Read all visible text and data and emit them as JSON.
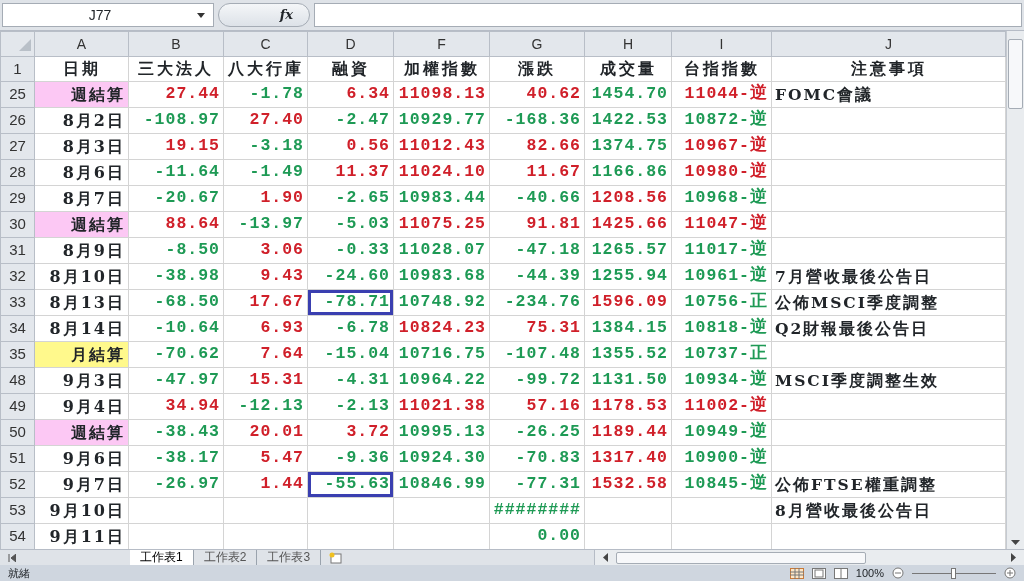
{
  "name_box": "J77",
  "formula_label": "fx",
  "columns": [
    "A",
    "B",
    "C",
    "D",
    "F",
    "G",
    "H",
    "I",
    "J"
  ],
  "header_row": {
    "number": "1",
    "labels": [
      "日期",
      "三大法人",
      "八大行庫",
      "融資",
      "加權指數",
      "漲跌",
      "成交量",
      "台指指數",
      "注意事項"
    ]
  },
  "rows": [
    {
      "number": "25",
      "date": {
        "text": "週結算",
        "kind": "weekly"
      },
      "cells": [
        {
          "text": "27.44",
          "color": "#d0202a",
          "selected": false
        },
        {
          "text": "-1.78",
          "color": "#1e9a55",
          "selected": false
        },
        {
          "text": "6.34",
          "color": "#d0202a",
          "selected": false
        },
        {
          "text": "11098.13",
          "color": "#d0202a",
          "selected": false
        },
        {
          "text": "40.62",
          "color": "#d0202a",
          "selected": false
        },
        {
          "text": "1454.70",
          "color": "#1e9a55",
          "selected": false
        },
        {
          "text": "11044-逆",
          "color": "#d0202a",
          "selected": false
        }
      ],
      "note": "FOMC會議"
    },
    {
      "number": "26",
      "date": {
        "text": "8月2日",
        "kind": "day"
      },
      "cells": [
        {
          "text": "-108.97",
          "color": "#1e9a55",
          "selected": false
        },
        {
          "text": "27.40",
          "color": "#d0202a",
          "selected": false
        },
        {
          "text": "-2.47",
          "color": "#1e9a55",
          "selected": false
        },
        {
          "text": "10929.77",
          "color": "#1e9a55",
          "selected": false
        },
        {
          "text": "-168.36",
          "color": "#1e9a55",
          "selected": false
        },
        {
          "text": "1422.53",
          "color": "#1e9a55",
          "selected": false
        },
        {
          "text": "10872-逆",
          "color": "#1e9a55",
          "selected": false
        }
      ]
    },
    {
      "number": "27",
      "date": {
        "text": "8月3日",
        "kind": "day"
      },
      "cells": [
        {
          "text": "19.15",
          "color": "#d0202a",
          "selected": false
        },
        {
          "text": "-3.18",
          "color": "#1e9a55",
          "selected": false
        },
        {
          "text": "0.56",
          "color": "#d0202a",
          "selected": false
        },
        {
          "text": "11012.43",
          "color": "#d0202a",
          "selected": false
        },
        {
          "text": "82.66",
          "color": "#d0202a",
          "selected": false
        },
        {
          "text": "1374.75",
          "color": "#1e9a55",
          "selected": false
        },
        {
          "text": "10967-逆",
          "color": "#d0202a",
          "selected": false
        }
      ]
    },
    {
      "number": "28",
      "date": {
        "text": "8月6日",
        "kind": "day"
      },
      "cells": [
        {
          "text": "-11.64",
          "color": "#1e9a55",
          "selected": false
        },
        {
          "text": "-1.49",
          "color": "#1e9a55",
          "selected": false
        },
        {
          "text": "11.37",
          "color": "#d0202a",
          "selected": false
        },
        {
          "text": "11024.10",
          "color": "#d0202a",
          "selected": false
        },
        {
          "text": "11.67",
          "color": "#d0202a",
          "selected": false
        },
        {
          "text": "1166.86",
          "color": "#1e9a55",
          "selected": false
        },
        {
          "text": "10980-逆",
          "color": "#d0202a",
          "selected": false
        }
      ]
    },
    {
      "number": "29",
      "date": {
        "text": "8月7日",
        "kind": "day"
      },
      "cells": [
        {
          "text": "-20.67",
          "color": "#1e9a55",
          "selected": false
        },
        {
          "text": "1.90",
          "color": "#d0202a",
          "selected": false
        },
        {
          "text": "-2.65",
          "color": "#1e9a55",
          "selected": false
        },
        {
          "text": "10983.44",
          "color": "#1e9a55",
          "selected": false
        },
        {
          "text": "-40.66",
          "color": "#1e9a55",
          "selected": false
        },
        {
          "text": "1208.56",
          "color": "#d0202a",
          "selected": false
        },
        {
          "text": "10968-逆",
          "color": "#1e9a55",
          "selected": false
        }
      ]
    },
    {
      "number": "30",
      "date": {
        "text": "週結算",
        "kind": "weekly"
      },
      "cells": [
        {
          "text": "88.64",
          "color": "#d0202a",
          "selected": false
        },
        {
          "text": "-13.97",
          "color": "#1e9a55",
          "selected": false
        },
        {
          "text": "-5.03",
          "color": "#1e9a55",
          "selected": false
        },
        {
          "text": "11075.25",
          "color": "#d0202a",
          "selected": false
        },
        {
          "text": "91.81",
          "color": "#d0202a",
          "selected": false
        },
        {
          "text": "1425.66",
          "color": "#d0202a",
          "selected": false
        },
        {
          "text": "11047-逆",
          "color": "#d0202a",
          "selected": false
        }
      ]
    },
    {
      "number": "31",
      "date": {
        "text": "8月9日",
        "kind": "day"
      },
      "cells": [
        {
          "text": "-8.50",
          "color": "#1e9a55",
          "selected": false
        },
        {
          "text": "3.06",
          "color": "#d0202a",
          "selected": false
        },
        {
          "text": "-0.33",
          "color": "#1e9a55",
          "selected": false
        },
        {
          "text": "11028.07",
          "color": "#1e9a55",
          "selected": false
        },
        {
          "text": "-47.18",
          "color": "#1e9a55",
          "selected": false
        },
        {
          "text": "1265.57",
          "color": "#1e9a55",
          "selected": false
        },
        {
          "text": "11017-逆",
          "color": "#1e9a55",
          "selected": false
        }
      ]
    },
    {
      "number": "32",
      "date": {
        "text": "8月10日",
        "kind": "day"
      },
      "cells": [
        {
          "text": "-38.98",
          "color": "#1e9a55",
          "selected": false
        },
        {
          "text": "9.43",
          "color": "#d0202a",
          "selected": false
        },
        {
          "text": "-24.60",
          "color": "#1e9a55",
          "selected": false
        },
        {
          "text": "10983.68",
          "color": "#1e9a55",
          "selected": false
        },
        {
          "text": "-44.39",
          "color": "#1e9a55",
          "selected": false
        },
        {
          "text": "1255.94",
          "color": "#1e9a55",
          "selected": false
        },
        {
          "text": "10961-逆",
          "color": "#1e9a55",
          "selected": false
        }
      ],
      "note": "7月營收最後公告日"
    },
    {
      "number": "33",
      "date": {
        "text": "8月13日",
        "kind": "day"
      },
      "cells": [
        {
          "text": "-68.50",
          "color": "#1e9a55",
          "selected": false
        },
        {
          "text": "17.67",
          "color": "#d0202a",
          "selected": false
        },
        {
          "text": "-78.71",
          "color": "#1e9a55",
          "selected": true
        },
        {
          "text": "10748.92",
          "color": "#1e9a55",
          "selected": false
        },
        {
          "text": "-234.76",
          "color": "#1e9a55",
          "selected": false
        },
        {
          "text": "1596.09",
          "color": "#d0202a",
          "selected": false
        },
        {
          "text": "10756-正",
          "color": "#1e9a55",
          "selected": false
        }
      ],
      "note": "公佈MSCI季度調整"
    },
    {
      "number": "34",
      "date": {
        "text": "8月14日",
        "kind": "day"
      },
      "cells": [
        {
          "text": "-10.64",
          "color": "#1e9a55",
          "selected": false
        },
        {
          "text": "6.93",
          "color": "#d0202a",
          "selected": false
        },
        {
          "text": "-6.78",
          "color": "#1e9a55",
          "selected": false
        },
        {
          "text": "10824.23",
          "color": "#d0202a",
          "selected": false
        },
        {
          "text": "75.31",
          "color": "#d0202a",
          "selected": false
        },
        {
          "text": "1384.15",
          "color": "#1e9a55",
          "selected": false
        },
        {
          "text": "10818-逆",
          "color": "#1e9a55",
          "selected": false
        }
      ],
      "note": "Q2財報最後公告日"
    },
    {
      "number": "35",
      "date": {
        "text": "月結算",
        "kind": "monthly"
      },
      "cells": [
        {
          "text": "-70.62",
          "color": "#1e9a55",
          "selected": false
        },
        {
          "text": "7.64",
          "color": "#d0202a",
          "selected": false
        },
        {
          "text": "-15.04",
          "color": "#1e9a55",
          "selected": false
        },
        {
          "text": "10716.75",
          "color": "#1e9a55",
          "selected": false
        },
        {
          "text": "-107.48",
          "color": "#1e9a55",
          "selected": false
        },
        {
          "text": "1355.52",
          "color": "#1e9a55",
          "selected": false
        },
        {
          "text": "10737-正",
          "color": "#1e9a55",
          "selected": false
        }
      ]
    },
    {
      "number": "48",
      "date": {
        "text": "9月3日",
        "kind": "day"
      },
      "cells": [
        {
          "text": "-47.97",
          "color": "#1e9a55",
          "selected": false
        },
        {
          "text": "15.31",
          "color": "#d0202a",
          "selected": false
        },
        {
          "text": "-4.31",
          "color": "#1e9a55",
          "selected": false
        },
        {
          "text": "10964.22",
          "color": "#1e9a55",
          "selected": false
        },
        {
          "text": "-99.72",
          "color": "#1e9a55",
          "selected": false
        },
        {
          "text": "1131.50",
          "color": "#1e9a55",
          "selected": false
        },
        {
          "text": "10934-逆",
          "color": "#1e9a55",
          "selected": false
        }
      ],
      "note": "MSCI季度調整生效"
    },
    {
      "number": "49",
      "date": {
        "text": "9月4日",
        "kind": "day"
      },
      "cells": [
        {
          "text": "34.94",
          "color": "#d0202a",
          "selected": false
        },
        {
          "text": "-12.13",
          "color": "#1e9a55",
          "selected": false
        },
        {
          "text": "-2.13",
          "color": "#1e9a55",
          "selected": false
        },
        {
          "text": "11021.38",
          "color": "#d0202a",
          "selected": false
        },
        {
          "text": "57.16",
          "color": "#d0202a",
          "selected": false
        },
        {
          "text": "1178.53",
          "color": "#d0202a",
          "selected": false
        },
        {
          "text": "11002-逆",
          "color": "#d0202a",
          "selected": false
        }
      ]
    },
    {
      "number": "50",
      "date": {
        "text": "週結算",
        "kind": "weekly"
      },
      "cells": [
        {
          "text": "-38.43",
          "color": "#1e9a55",
          "selected": false
        },
        {
          "text": "20.01",
          "color": "#d0202a",
          "selected": false
        },
        {
          "text": "3.72",
          "color": "#d0202a",
          "selected": false
        },
        {
          "text": "10995.13",
          "color": "#1e9a55",
          "selected": false
        },
        {
          "text": "-26.25",
          "color": "#1e9a55",
          "selected": false
        },
        {
          "text": "1189.44",
          "color": "#d0202a",
          "selected": false
        },
        {
          "text": "10949-逆",
          "color": "#1e9a55",
          "selected": false
        }
      ]
    },
    {
      "number": "51",
      "date": {
        "text": "9月6日",
        "kind": "day"
      },
      "cells": [
        {
          "text": "-38.17",
          "color": "#1e9a55",
          "selected": false
        },
        {
          "text": "5.47",
          "color": "#d0202a",
          "selected": false
        },
        {
          "text": "-9.36",
          "color": "#1e9a55",
          "selected": false
        },
        {
          "text": "10924.30",
          "color": "#1e9a55",
          "selected": false
        },
        {
          "text": "-70.83",
          "color": "#1e9a55",
          "selected": false
        },
        {
          "text": "1317.40",
          "color": "#d0202a",
          "selected": false
        },
        {
          "text": "10900-逆",
          "color": "#1e9a55",
          "selected": false
        }
      ]
    },
    {
      "number": "52",
      "date": {
        "text": "9月7日",
        "kind": "day"
      },
      "cells": [
        {
          "text": "-26.97",
          "color": "#1e9a55",
          "selected": false
        },
        {
          "text": "1.44",
          "color": "#d0202a",
          "selected": false
        },
        {
          "text": "-55.63",
          "color": "#1e9a55",
          "selected": true
        },
        {
          "text": "10846.99",
          "color": "#1e9a55",
          "selected": false
        },
        {
          "text": "-77.31",
          "color": "#1e9a55",
          "selected": false
        },
        {
          "text": "1532.58",
          "color": "#d0202a",
          "selected": false
        },
        {
          "text": "10845-逆",
          "color": "#1e9a55",
          "selected": false
        }
      ],
      "note": "公佈FTSE權重調整"
    },
    {
      "number": "53",
      "date": {
        "text": "9月10日",
        "kind": "day"
      },
      "cells": [
        {
          "selected": false
        },
        {
          "selected": false
        },
        {
          "selected": false
        },
        {
          "selected": false
        },
        {
          "text": "########",
          "color": "#1e9a55",
          "selected": false
        },
        {
          "selected": false
        },
        {
          "selected": false
        }
      ],
      "note": "8月營收最後公告日"
    },
    {
      "number": "54",
      "date": {
        "text": "9月11日",
        "kind": "day"
      },
      "cells": [
        {
          "selected": false
        },
        {
          "selected": false
        },
        {
          "selected": false
        },
        {
          "selected": false
        },
        {
          "text": "0.00",
          "color": "#1e9a55",
          "selected": false
        },
        {
          "selected": false
        },
        {
          "selected": false
        }
      ]
    }
  ],
  "sheet_tabs": [
    {
      "label": "工作表1",
      "selected": true
    },
    {
      "label": "工作表2",
      "selected": false
    },
    {
      "label": "工作表3",
      "selected": false
    }
  ],
  "status_bar": {
    "text": "就緒",
    "zoom": "100%",
    "zoom_slider": {
      "level": 0.5
    }
  }
}
